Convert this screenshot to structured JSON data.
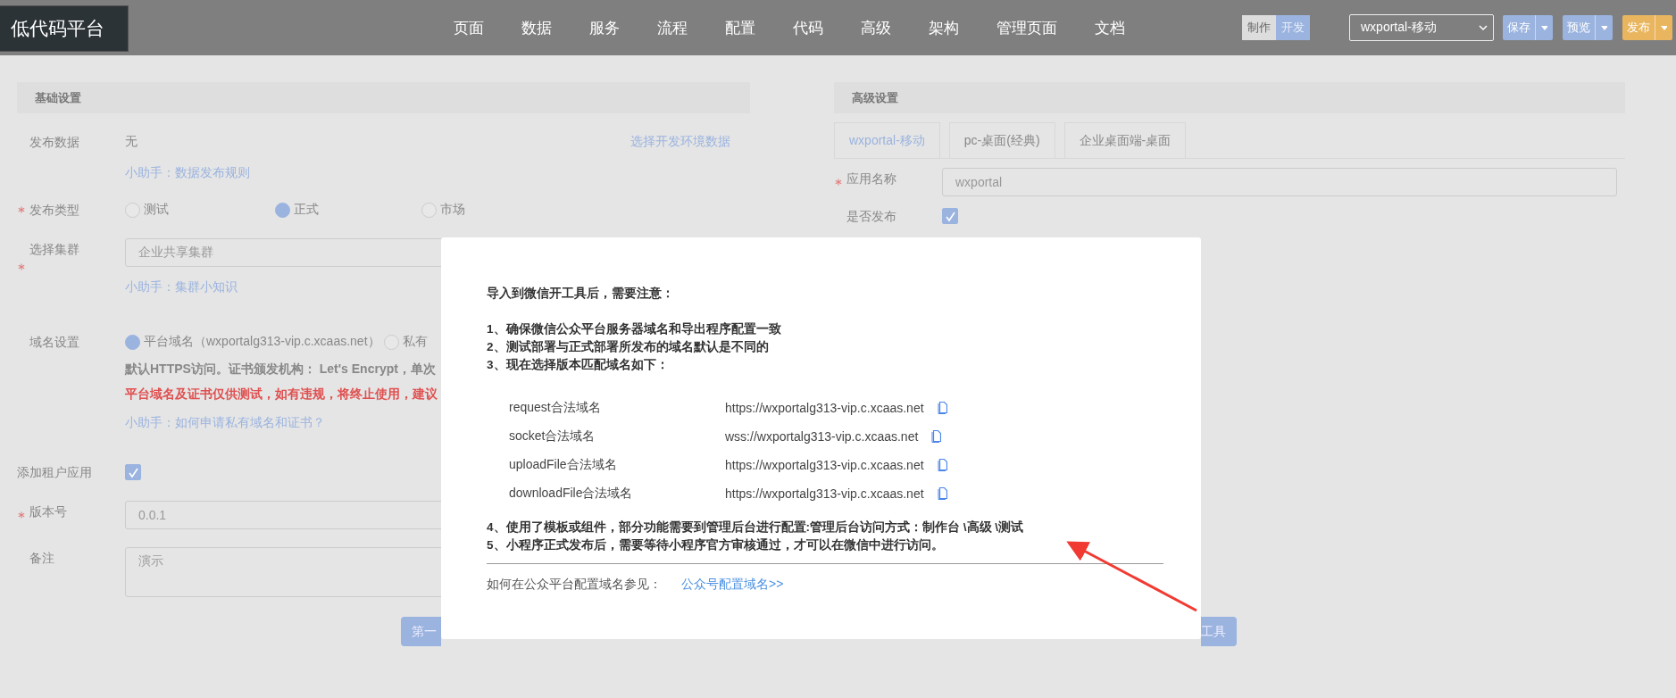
{
  "header": {
    "logo": "低代码平台",
    "nav": [
      {
        "label": "页面"
      },
      {
        "label": "数据"
      },
      {
        "label": "服务"
      },
      {
        "label": "流程"
      },
      {
        "label": "配置"
      },
      {
        "label": "代码"
      },
      {
        "label": "高级"
      },
      {
        "label": "架构"
      },
      {
        "label": "管理页面"
      },
      {
        "label": "文档"
      }
    ],
    "mode_toggle": [
      {
        "label": "制作",
        "selected": false
      },
      {
        "label": "开发",
        "selected": true
      }
    ],
    "app_select": {
      "value": "wxportal-移动"
    },
    "actions": [
      {
        "label": "保存",
        "color": "#9ab3df"
      },
      {
        "label": "预览",
        "color": "#9ab3df"
      },
      {
        "label": "发布",
        "color": "#e9b65f"
      }
    ]
  },
  "basic_settings": {
    "title": "基础设置",
    "rows": [
      {
        "kind": "text",
        "label": "发布数据",
        "required": false,
        "value": "无",
        "action_link": "选择开发环境数据",
        "help": "小助手：数据发布规则"
      },
      {
        "kind": "radio",
        "label": "发布类型",
        "required": true,
        "options": [
          {
            "label": "测试",
            "selected": false
          },
          {
            "label": "正式",
            "selected": true
          },
          {
            "label": "市场",
            "selected": false
          }
        ]
      },
      {
        "kind": "input",
        "label": "选择集群",
        "required": true,
        "value": "企业共享集群",
        "help": "小助手：集群小知识"
      },
      {
        "kind": "radio",
        "label": "域名设置",
        "required": false,
        "options": [
          {
            "label": "平台域名（wxportalg313-vip.c.xcaas.net）",
            "selected": true
          },
          {
            "label": "私有",
            "selected": false
          }
        ],
        "notes": [
          {
            "kind": "info",
            "text": "默认HTTPS访问。证书颁发机构： Let's Encrypt，单次"
          },
          {
            "kind": "warning",
            "text": "平台域名及证书仅供测试，如有违规，将终止使用，建议"
          }
        ],
        "help": "小助手：如何申请私有域名和证书？"
      },
      {
        "kind": "checkbox",
        "label": "添加租户应用",
        "required": false,
        "checked": true
      },
      {
        "kind": "input",
        "label": "版本号",
        "required": true,
        "value": "0.0.1"
      },
      {
        "kind": "textarea",
        "label": "备注",
        "required": false,
        "value": "演示"
      }
    ]
  },
  "advanced_settings": {
    "title": "高级设置",
    "tabs": [
      {
        "label": "wxportal-移动",
        "selected": true
      },
      {
        "label": "pc-桌面(经典)",
        "selected": false
      },
      {
        "label": "企业桌面端-桌面",
        "selected": false
      }
    ],
    "rows": [
      {
        "kind": "input",
        "label": "应用名称",
        "required": true,
        "value": "wxportal"
      },
      {
        "kind": "checkbox",
        "label": "是否发布",
        "required": false,
        "checked": true
      }
    ]
  },
  "buttons": [
    {
      "label": "第一"
    },
    {
      "label": "工具"
    }
  ],
  "modal": {
    "heading": "导入到微信开工具后，需要注意：",
    "notes_top": [
      "1、确保微信公众平台服务器域名和导出程序配置一致",
      "2、测试部署与正式部署所发布的域名默认是不同的",
      "3、现在选择版本匹配域名如下："
    ],
    "domains": [
      {
        "name": "request合法域名",
        "url": "https://wxportalg313-vip.c.xcaas.net"
      },
      {
        "name": "socket合法域名",
        "url": "wss://wxportalg313-vip.c.xcaas.net"
      },
      {
        "name": "uploadFile合法域名",
        "url": "https://wxportalg313-vip.c.xcaas.net"
      },
      {
        "name": "downloadFile合法域名",
        "url": "https://wxportalg313-vip.c.xcaas.net"
      }
    ],
    "notes_bottom": [
      "4、使用了模板或组件，部分功能需要到管理后台进行配置:管理后台访问方式：制作台 \\高级 \\测试",
      "5、小程序正式发布后，需要等待小程序官方审核通过，才可以在微信中进行访问。"
    ],
    "footer_text": "如何在公众平台配置域名参见：",
    "footer_link": "公众号配置域名>>"
  }
}
